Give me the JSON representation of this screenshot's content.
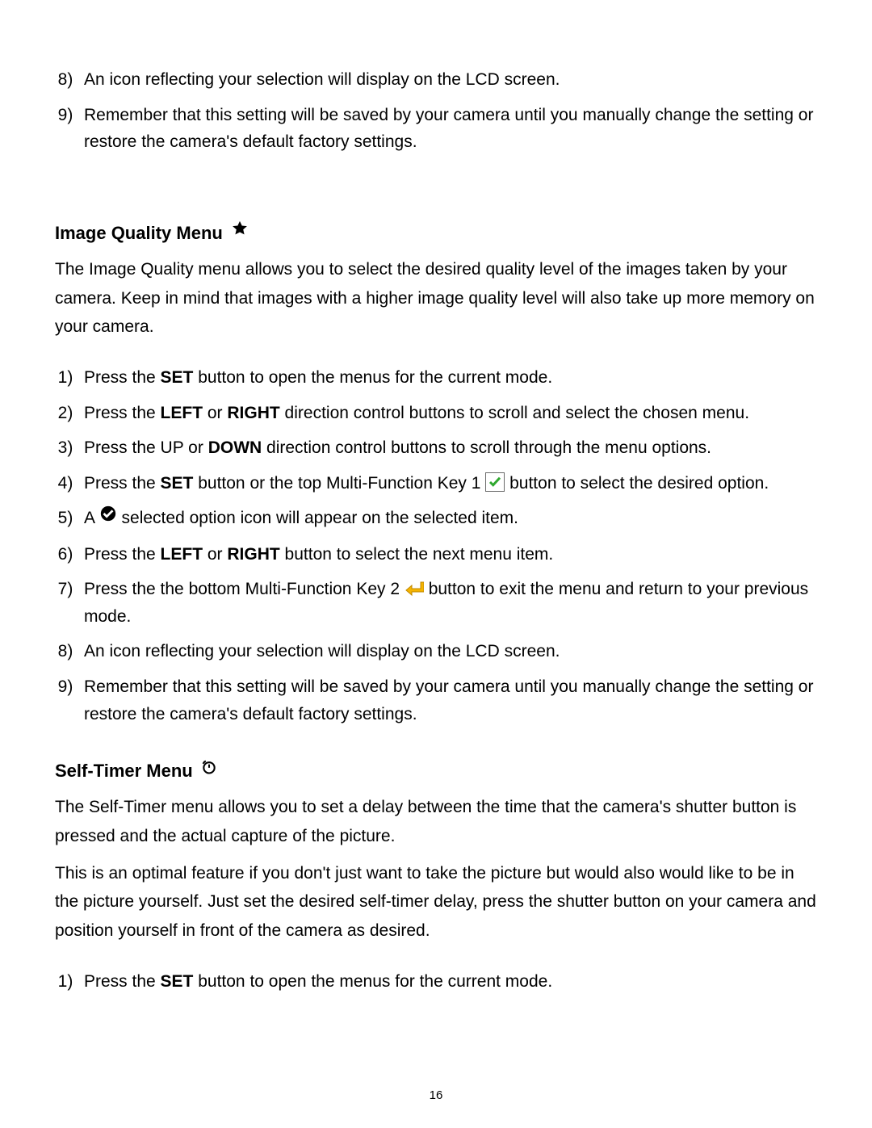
{
  "top_list": {
    "start": 8,
    "items": [
      "An icon reflecting your selection will display on the LCD screen.",
      "Remember that this setting will be saved by your camera until you manually change the setting or restore the camera's default factory settings."
    ]
  },
  "image_quality": {
    "heading": "Image Quality Menu",
    "intro": "The Image Quality menu allows you to select the desired quality level of the images taken by your camera. Keep in mind that images with a higher image quality level will also take up more memory on your camera.",
    "steps": {
      "s1_pre": "Press the ",
      "s1_set": "SET",
      "s1_post": " button to open the menus for the current mode.",
      "s2_pre": "Press the ",
      "s2_left": "LEFT",
      "s2_mid": " or ",
      "s2_right": "RIGHT",
      "s2_post": " direction control buttons to scroll and select the chosen menu.",
      "s3_pre": "Press the UP or ",
      "s3_down": "DOWN",
      "s3_post": " direction control buttons to scroll through the menu options.",
      "s4_pre": "Press the ",
      "s4_set": "SET",
      "s4_mid": " button or the top Multi-Function Key 1  ",
      "s4_post": "  button to select the desired option.",
      "s5_pre": "A  ",
      "s5_post": " selected option icon will appear on the selected item.",
      "s6_pre": "Press the ",
      "s6_left": "LEFT",
      "s6_mid": " or ",
      "s6_right": "RIGHT",
      "s6_post": " button to select the next menu item.",
      "s7_pre": "Press the the bottom Multi-Function Key 2  ",
      "s7_post": "  button to exit the menu and return to your previous mode.",
      "s8": "An icon reflecting your selection will display on the LCD screen.",
      "s9": "Remember that this setting will be saved by your camera until you manually change the setting or restore the camera's default factory settings."
    }
  },
  "self_timer": {
    "heading": "Self-Timer Menu",
    "intro1": "The Self-Timer menu allows you to set a delay between the time that the camera's shutter button is pressed and the actual capture of the picture.",
    "intro2": "This is an optimal feature if you don't just want to take the picture but would also would like to be in the picture yourself. Just set the desired self-timer delay, press the shutter button on your camera and position yourself in front of the camera as desired.",
    "steps": {
      "s1_pre": "Press the ",
      "s1_set": "SET",
      "s1_post": " button to open the menus for the current mode."
    }
  },
  "page_number": "16"
}
